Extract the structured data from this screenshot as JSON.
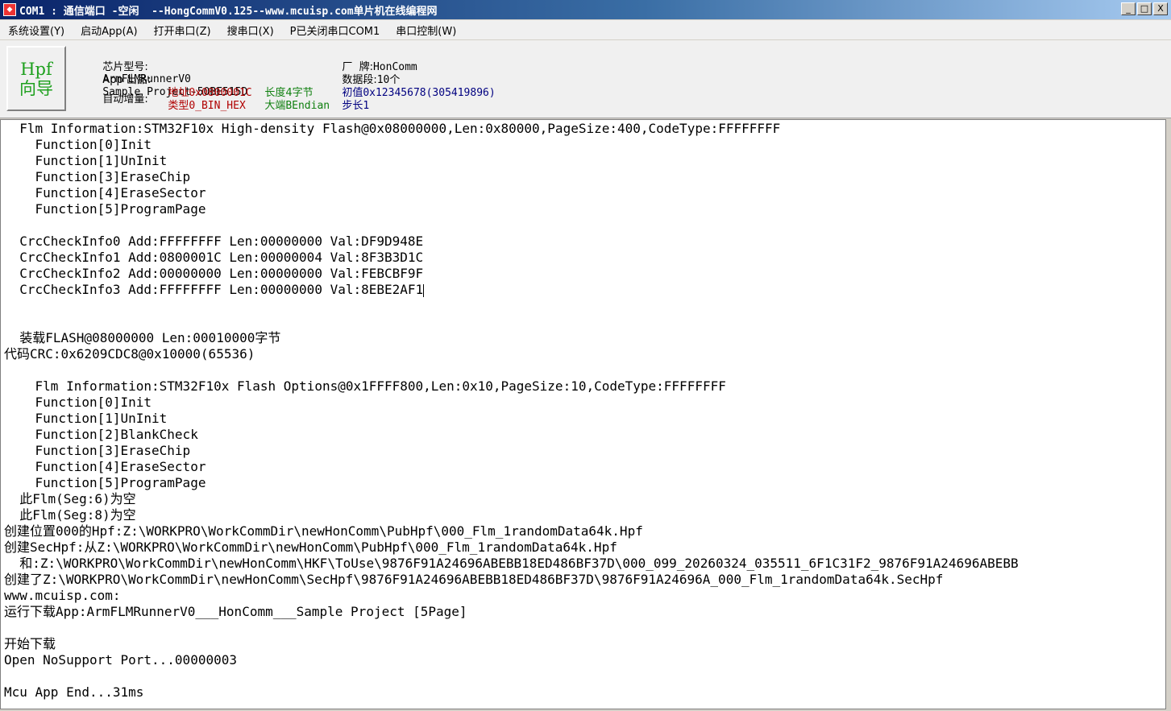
{
  "window": {
    "title": "COM1 : 通信端口 -空闲  --HongCommV0.125--www.mcuisp.com单片机在线编程网",
    "controls": [
      "_",
      "□",
      "X"
    ]
  },
  "menu": [
    "系统设置(Y)",
    "启动App(A)",
    "打开串口(Z)",
    "搜串口(X)",
    "P已关闭串口COM1",
    "串口控制(W)"
  ],
  "hpf_button": {
    "line1": "Hpf",
    "line2": "向导"
  },
  "info": {
    "chip_label": "芯片型号:",
    "chip_value": "ArmFLMRunnerV0",
    "brand_label": "厂  牌:",
    "brand_value": "HonComm",
    "app_label": "App 出品:",
    "app_value": "Sample Project-50BE515D",
    "seg_label": "数据段:",
    "seg_value": "10个",
    "auto_label": "自动增量:",
    "addr_label": "地址",
    "addr_value": "0x0800001C",
    "len_label": "长度4字节",
    "init_label": "初值",
    "init_value": "0x12345678(305419896)",
    "type_label": "类型",
    "type_value": "0_BIN_HEX",
    "endian_label": "大端",
    "endian_value": "BEndian",
    "step_label": "步长",
    "step_value": "1"
  },
  "log_lines": [
    "  Flm Information:STM32F10x High-density Flash@0x08000000,Len:0x80000,PageSize:400,CodeType:FFFFFFFF",
    "    Function[0]Init",
    "    Function[1]UnInit",
    "    Function[3]EraseChip",
    "    Function[4]EraseSector",
    "    Function[5]ProgramPage",
    "",
    "  CrcCheckInfo0 Add:FFFFFFFF Len:00000000 Val:DF9D948E",
    "  CrcCheckInfo1 Add:0800001C Len:00000004 Val:8F3B3D1C",
    "  CrcCheckInfo2 Add:00000000 Len:00000000 Val:FEBCBF9F",
    "  CrcCheckInfo3 Add:FFFFFFFF Len:00000000 Val:8EBE2AF1",
    "",
    "",
    "  装载FLASH@08000000 Len:00010000字节",
    "代码CRC:0x6209CDC8@0x10000(65536)",
    "",
    "    Flm Information:STM32F10x Flash Options@0x1FFFF800,Len:0x10,PageSize:10,CodeType:FFFFFFFF",
    "    Function[0]Init",
    "    Function[1]UnInit",
    "    Function[2]BlankCheck",
    "    Function[3]EraseChip",
    "    Function[4]EraseSector",
    "    Function[5]ProgramPage",
    "  此Flm(Seg:6)为空",
    "  此Flm(Seg:8)为空",
    "创建位置000的Hpf:Z:\\WORKPRO\\WorkCommDir\\newHonComm\\PubHpf\\000_Flm_1randomData64k.Hpf",
    "创建SecHpf:从Z:\\WORKPRO\\WorkCommDir\\newHonComm\\PubHpf\\000_Flm_1randomData64k.Hpf",
    "  和:Z:\\WORKPRO\\WorkCommDir\\newHonComm\\HKF\\ToUse\\9876F91A24696ABEBB18ED486BF37D\\000_099_20260324_035511_6F1C31F2_9876F91A24696ABEBB",
    "创建了Z:\\WORKPRO\\WorkCommDir\\newHonComm\\SecHpf\\9876F91A24696ABEBB18ED486BF37D\\9876F91A24696A_000_Flm_1randomData64k.SecHpf",
    "www.mcuisp.com:",
    "运行下载App:ArmFLMRunnerV0___HonComm___Sample Project [5Page]",
    "",
    "开始下载",
    "Open NoSupport Port...00000003",
    "",
    "Mcu App End...31ms"
  ],
  "colors": {
    "title_gradient_start": "#0a246a",
    "label_red": "#b00000",
    "label_green": "#108010",
    "label_blue": "#000080",
    "hpf_green": "#1ea01e"
  }
}
